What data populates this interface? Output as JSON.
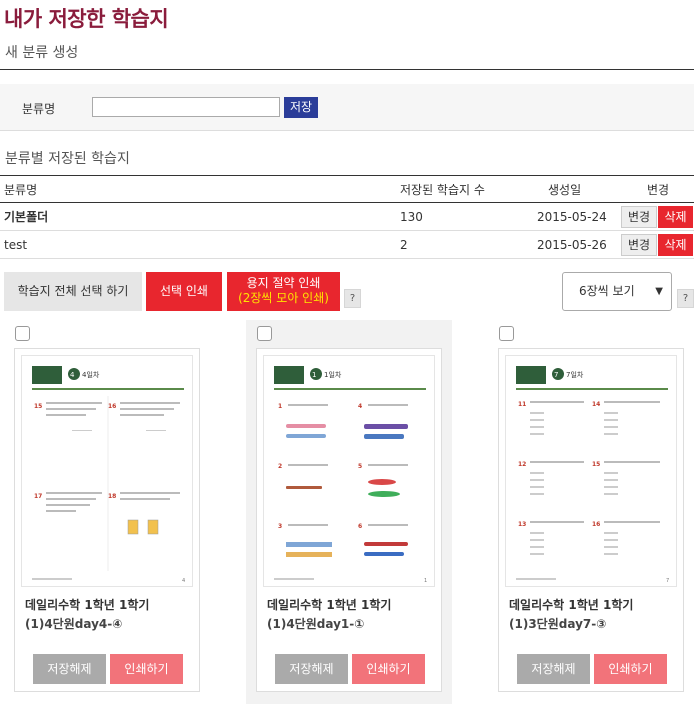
{
  "page": {
    "title": "내가 저장한 학습지",
    "new_category_title": "새 분류 생성",
    "saved_by_category_title": "분류별 저장된 학습지"
  },
  "form": {
    "label": "분류명",
    "input_value": "",
    "save_label": "저장"
  },
  "table": {
    "headers": {
      "name": "분류명",
      "count": "저장된 학습지 수",
      "date": "생성일",
      "action": "변경"
    },
    "rows": [
      {
        "name": "기본폴더",
        "count": "130",
        "date": "2015-05-24",
        "edit": "변경",
        "delete": "삭제"
      },
      {
        "name": "test",
        "count": "2",
        "date": "2015-05-26",
        "edit": "변경",
        "delete": "삭제"
      }
    ]
  },
  "toolbar": {
    "select_all": "학습지 전체 선택 하기",
    "print_selected": "선택 인쇄",
    "paper_saving_print": "용지 절약 인쇄",
    "paper_saving_sub": "(2장씩 모아 인쇄)",
    "help": "?",
    "view_option": "6장씩 보기"
  },
  "cards": [
    {
      "title": "데일리수학 1학년 1학기",
      "sub": "(1)4단원day4-④",
      "unsave": "저장해제",
      "print": "인쇄하기",
      "thumb_day": "4일차",
      "thumb_num": "4"
    },
    {
      "title": "데일리수학 1학년 1학기",
      "sub": "(1)4단원day1-①",
      "unsave": "저장해제",
      "print": "인쇄하기",
      "thumb_day": "1일차",
      "thumb_num": "1"
    },
    {
      "title": "데일리수학 1학년 1학기",
      "sub": "(1)3단원day7-③",
      "unsave": "저장해제",
      "print": "인쇄하기",
      "thumb_day": "7일차",
      "thumb_num": "7"
    }
  ],
  "colors": {
    "title": "#8a1c3c",
    "accent_red": "#e8262e",
    "save_blue": "#2b3d99",
    "print_pink": "#f2737a"
  }
}
